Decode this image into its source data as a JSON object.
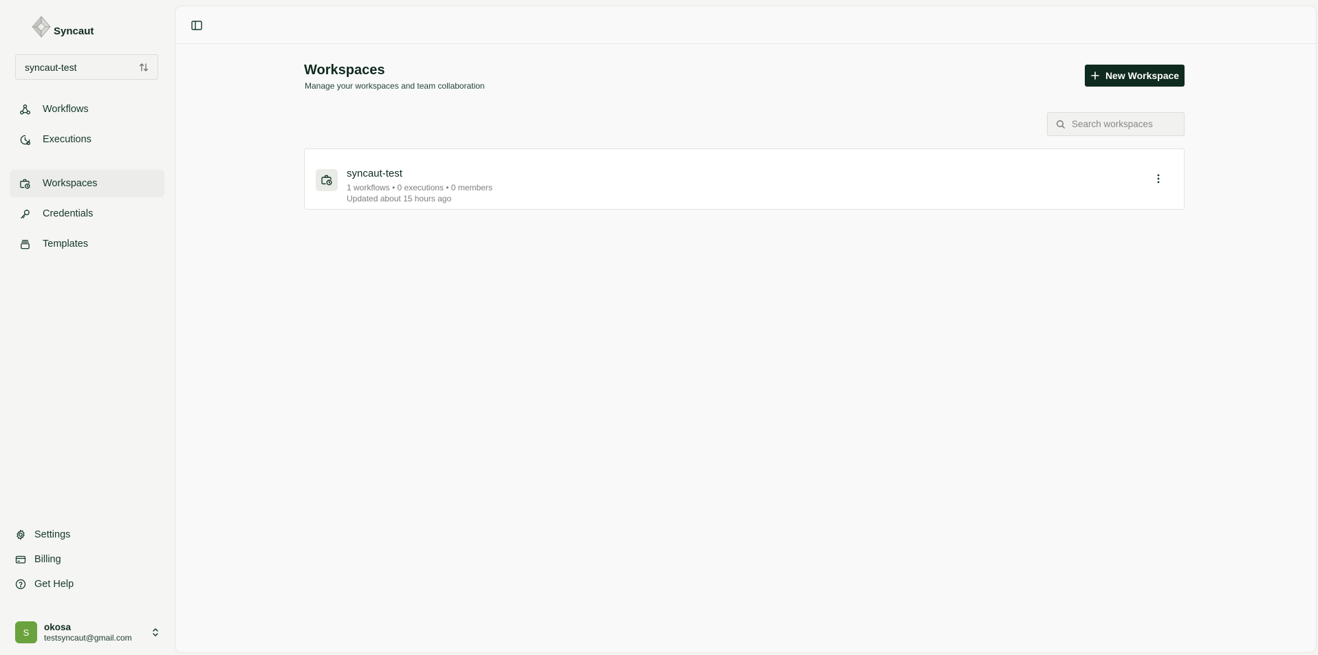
{
  "app": {
    "name": "Syncaut"
  },
  "workspace_switcher": {
    "current": "syncaut-test"
  },
  "nav": {
    "items": [
      {
        "label": "Workflows",
        "icon": "workflow-icon"
      },
      {
        "label": "Executions",
        "icon": "clock-icon"
      },
      {
        "label": "Workspaces",
        "icon": "briefcase-clock-icon",
        "active": true
      },
      {
        "label": "Credentials",
        "icon": "key-icon"
      },
      {
        "label": "Templates",
        "icon": "stack-icon"
      }
    ]
  },
  "bottom_nav": {
    "settings": "Settings",
    "billing": "Billing",
    "help": "Get Help"
  },
  "user": {
    "initial": "S",
    "name": "okosa",
    "email": "testsyncaut@gmail.com"
  },
  "page": {
    "title": "Workspaces",
    "subtitle": "Manage your workspaces and team collaboration",
    "new_button": "New Workspace",
    "search_placeholder": "Search workspaces"
  },
  "workspaces": [
    {
      "name": "syncaut-test",
      "meta": "1 workflows • 0 executions • 0 members",
      "updated": "Updated about 15 hours ago"
    }
  ],
  "colors": {
    "primary": "#0f2a1e",
    "avatar": "#6aa33d",
    "active_nav": "#ececea"
  }
}
